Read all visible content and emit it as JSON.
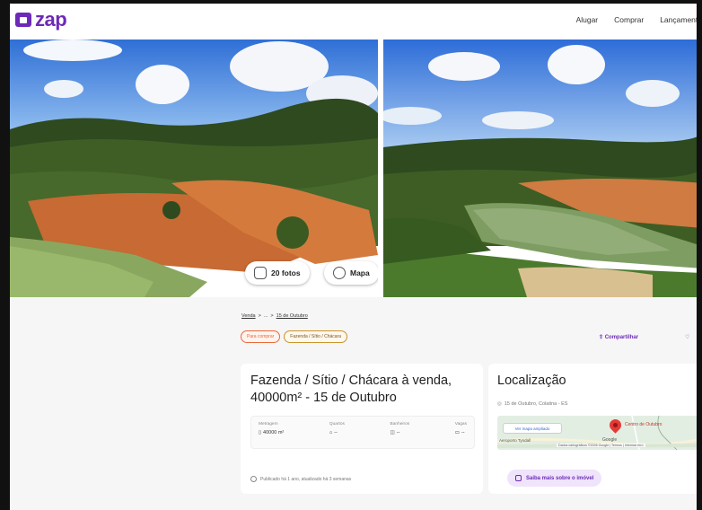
{
  "header": {
    "brand": "zap",
    "nav": [
      "Alugar",
      "Comprar",
      "Lançamento"
    ]
  },
  "gallery": {
    "photos_button": "20 fotos",
    "map_button": "Mapa"
  },
  "breadcrumb": {
    "items": [
      "Venda",
      ">",
      "...",
      ">",
      "15 de Outubro"
    ]
  },
  "tags": {
    "sale": "Para comprar",
    "type": "Fazenda / Sítio / Chácara"
  },
  "actions": {
    "share": "Compartilhar",
    "favorite": "♡"
  },
  "listing": {
    "title": "Fazenda / Sítio / Chácara à venda, 40000m² - 15 de Outubro",
    "stats": [
      {
        "label": "Metragem",
        "value": "40000 m²"
      },
      {
        "label": "Quartos",
        "value": "--"
      },
      {
        "label": "Banheiros",
        "value": "--"
      },
      {
        "label": "Vagas",
        "value": "--"
      }
    ],
    "published": "Publicado há 1 ano, atualizado há 3 semanas"
  },
  "location": {
    "title": "Localização",
    "address": "15 de Outubro, Colatina - ES",
    "map_button": "Ver mapa ampliado",
    "map_place": "Centro de Outubro",
    "map_area": "Aeroporto Tyndall",
    "map_brand": "Google",
    "map_credit": "Dados cartográficos ©2026 Google | Termos | Informar erro",
    "learn_more": "Saiba mais sobre o imóvel"
  },
  "colors": {
    "brand": "#6c2ab8",
    "sale_tag": "#e96a3c",
    "pin": "#e53935"
  }
}
